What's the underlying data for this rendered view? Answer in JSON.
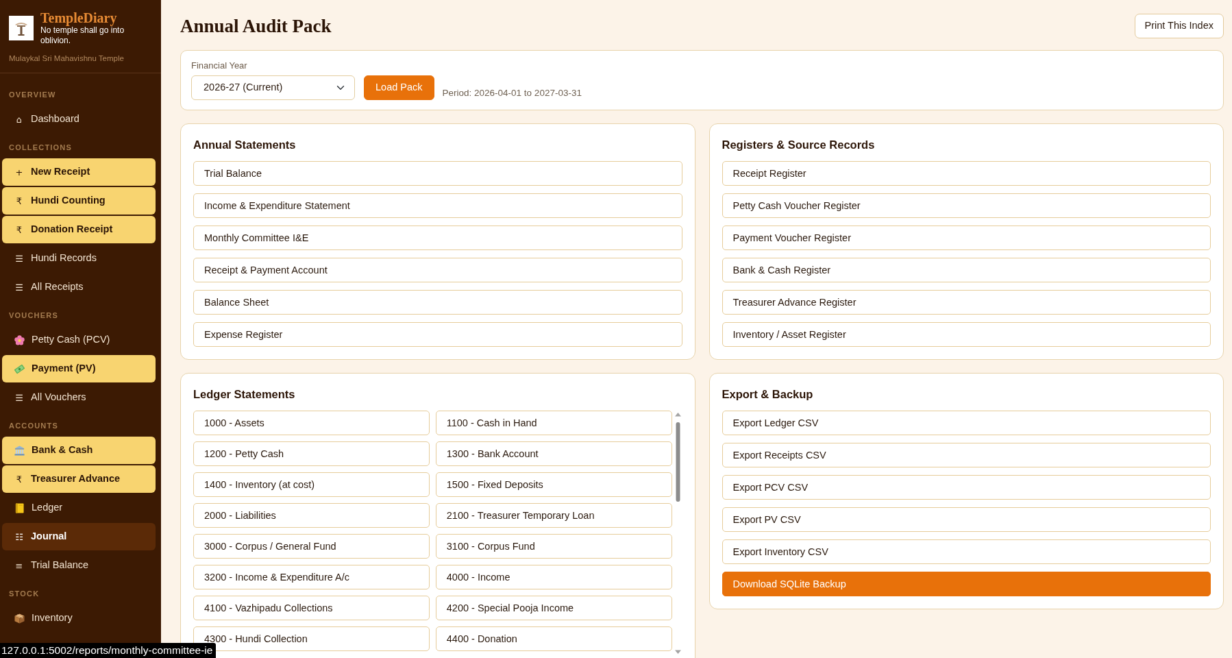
{
  "sidebar": {
    "brand": {
      "name": "TempleDiary",
      "tagline": "No temple shall go into oblivion.",
      "temple": "Mulaykal Sri Mahavishnu Temple"
    },
    "sections": [
      {
        "title": "OVERVIEW",
        "items": [
          {
            "label": "Dashboard",
            "glyph": "⌂",
            "kind": "link",
            "selected": false
          }
        ]
      },
      {
        "title": "COLLECTIONS",
        "items": [
          {
            "label": "New Receipt",
            "glyph": "+",
            "kind": "action",
            "selected": false
          },
          {
            "label": "Hundi Counting",
            "glyph": "₹",
            "kind": "action",
            "selected": false
          },
          {
            "label": "Donation Receipt",
            "glyph": "₹",
            "kind": "action",
            "selected": false
          },
          {
            "label": "Hundi Records",
            "glyph": "☰",
            "kind": "link",
            "selected": false
          },
          {
            "label": "All Receipts",
            "glyph": "☰",
            "kind": "link",
            "selected": false
          }
        ]
      },
      {
        "title": "VOUCHERS",
        "items": [
          {
            "label": "Petty Cash (PCV)",
            "kind": "link",
            "selected": false
          },
          {
            "label": "Payment (PV)",
            "kind": "action",
            "selected": false
          },
          {
            "label": "All Vouchers",
            "glyph": "☰",
            "kind": "link",
            "selected": false
          }
        ]
      },
      {
        "title": "ACCOUNTS",
        "items": [
          {
            "label": "Bank & Cash",
            "kind": "action",
            "selected": false
          },
          {
            "label": "Treasurer Advance",
            "glyph": "₹",
            "kind": "action",
            "selected": false
          },
          {
            "label": "Ledger",
            "kind": "link",
            "selected": false
          },
          {
            "label": "Journal",
            "glyph": "☷",
            "kind": "link",
            "selected": true
          },
          {
            "label": "Trial Balance",
            "glyph": "≡",
            "kind": "link",
            "selected": false
          }
        ]
      },
      {
        "title": "STOCK",
        "items": [
          {
            "label": "Inventory",
            "kind": "link",
            "selected": false
          }
        ]
      }
    ]
  },
  "page": {
    "title": "Annual Audit Pack",
    "print_button": "Print This Index"
  },
  "filter": {
    "label": "Financial Year",
    "value": "2026-27 (Current)",
    "button": "Load Pack",
    "period": "Period: 2026-04-01 to 2027-03-31"
  },
  "panels": [
    {
      "title": "Annual Statements",
      "kind": "list",
      "items": [
        {
          "label": "Trial Balance",
          "kind": "link"
        },
        {
          "label": "Income & Expenditure Statement",
          "kind": "link"
        },
        {
          "label": "Monthly Committee I&E",
          "kind": "link"
        },
        {
          "label": "Receipt & Payment Account",
          "kind": "link"
        },
        {
          "label": "Balance Sheet",
          "kind": "link"
        },
        {
          "label": "Expense Register",
          "kind": "link"
        }
      ]
    },
    {
      "title": "Registers & Source Records",
      "kind": "list",
      "items": [
        {
          "label": "Receipt Register",
          "kind": "link"
        },
        {
          "label": "Petty Cash Voucher Register",
          "kind": "link"
        },
        {
          "label": "Payment Voucher Register",
          "kind": "link"
        },
        {
          "label": "Bank & Cash Register",
          "kind": "link"
        },
        {
          "label": "Treasurer Advance Register",
          "kind": "link"
        },
        {
          "label": "Inventory / Asset Register",
          "kind": "link"
        }
      ]
    },
    {
      "title": "Ledger Statements",
      "kind": "grid",
      "items": [
        {
          "label": "1000 - Assets",
          "kind": "link"
        },
        {
          "label": "1100 - Cash in Hand",
          "kind": "link"
        },
        {
          "label": "1200 - Petty Cash",
          "kind": "link"
        },
        {
          "label": "1300 - Bank Account",
          "kind": "link"
        },
        {
          "label": "1400 - Inventory (at cost)",
          "kind": "link"
        },
        {
          "label": "1500 - Fixed Deposits",
          "kind": "link"
        },
        {
          "label": "2000 - Liabilities",
          "kind": "link"
        },
        {
          "label": "2100 - Treasurer Temporary Loan",
          "kind": "link"
        },
        {
          "label": "3000 - Corpus / General Fund",
          "kind": "link"
        },
        {
          "label": "3100 - Corpus Fund",
          "kind": "link"
        },
        {
          "label": "3200 - Income & Expenditure A/c",
          "kind": "link"
        },
        {
          "label": "4000 - Income",
          "kind": "link"
        },
        {
          "label": "4100 - Vazhipadu Collections",
          "kind": "link"
        },
        {
          "label": "4200 - Special Pooja Income",
          "kind": "link"
        },
        {
          "label": "4300 - Hundi Collection",
          "kind": "link"
        },
        {
          "label": "4400 - Donation",
          "kind": "link"
        }
      ]
    },
    {
      "title": "Export & Backup",
      "kind": "list",
      "items": [
        {
          "label": "Export Ledger CSV",
          "kind": "link"
        },
        {
          "label": "Export Receipts CSV",
          "kind": "link"
        },
        {
          "label": "Export PCV CSV",
          "kind": "link"
        },
        {
          "label": "Export PV CSV",
          "kind": "link"
        },
        {
          "label": "Export Inventory CSV",
          "kind": "link"
        },
        {
          "label": "Download SQLite Backup",
          "kind": "primary"
        }
      ]
    }
  ],
  "status_url": "127.0.0.1:5002/reports/monthly-committee-ie"
}
